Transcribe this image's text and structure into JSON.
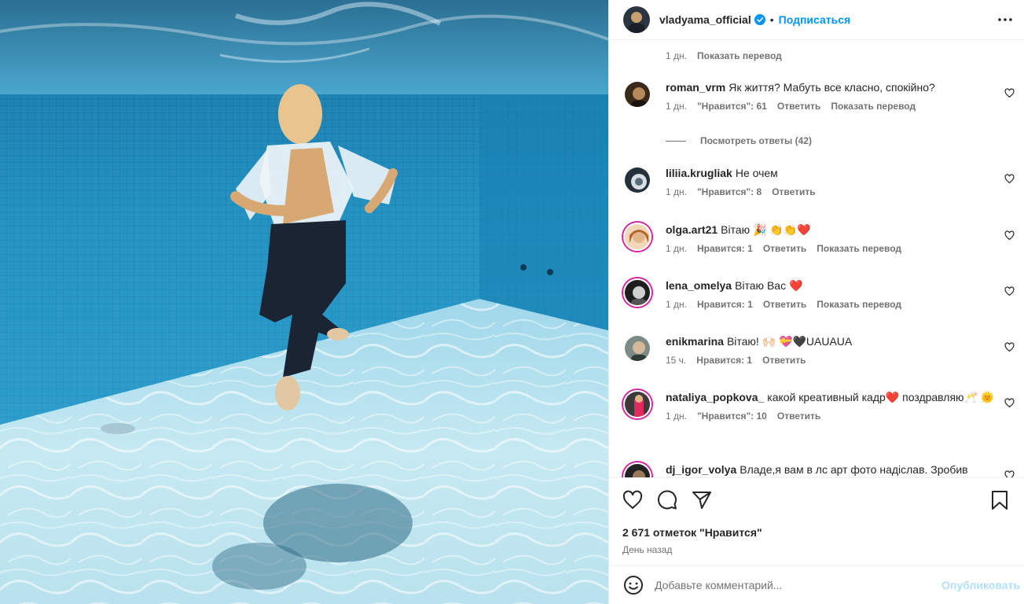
{
  "post": {
    "username": "vladyama_official",
    "follow_label": "Подписаться",
    "separator": "•"
  },
  "top_meta": {
    "time": "1 дн.",
    "translate": "Показать перевод"
  },
  "comments": [
    {
      "user": "roman_vrm",
      "text": "Як життя? Мабуть все класно, спокійно?",
      "time": "1 дн.",
      "likes": "\"Нравится\": 61",
      "reply": "Ответить",
      "translate": "Показать перевод",
      "view_replies": "Посмотреть ответы (42)"
    },
    {
      "user": "liliia.krugliak",
      "text": "Не очем",
      "time": "1 дн.",
      "likes": "\"Нравится\": 8",
      "reply": "Ответить"
    },
    {
      "user": "olga.art21",
      "text": "Вітаю 🎉 👏👏❤️",
      "time": "1 дн.",
      "likes": "Нравится: 1",
      "reply": "Ответить",
      "translate": "Показать перевод"
    },
    {
      "user": "lena_omelya",
      "text": "Вітаю Вас ❤️",
      "time": "1 дн.",
      "likes": "Нравится: 1",
      "reply": "Ответить",
      "translate": "Показать перевод"
    },
    {
      "user": "enikmarina",
      "text": "Вітаю! 🙌🏻 💝🖤UAUAUA",
      "time": "15 ч.",
      "likes": "Нравится: 1",
      "reply": "Ответить"
    },
    {
      "user": "nataliya_popkova_",
      "text": "какой креативный кадр❤️ поздравляю🥂 🌞",
      "time": "1 дн.",
      "likes": "\"Нравится\": 10",
      "reply": "Ответить"
    },
    {
      "user": "dj_igor_volya",
      "text": "Владе,я вам в лс арт фото надіслав. Зробив"
    }
  ],
  "actions": {
    "like_icon": "heart-icon",
    "comment_icon": "comment-icon",
    "share_icon": "paper-plane-icon",
    "save_icon": "bookmark-icon",
    "likes_count": "2 671 отметок \"Нравится\"",
    "posted": "День назад"
  },
  "composer": {
    "placeholder": "Добавьте комментарий...",
    "publish_label": "Опубликовать"
  },
  "colors": {
    "accent": "#0095f6",
    "publish_disabled": "#b2dffc",
    "muted": "#737373",
    "text": "#262626",
    "story_ring": "#d6249f"
  }
}
